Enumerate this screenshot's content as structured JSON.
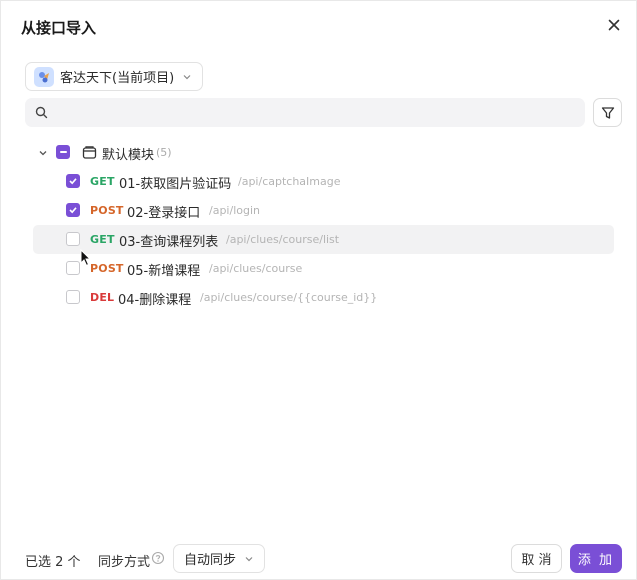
{
  "dialog": {
    "title": "从接口导入",
    "close_icon": "close-icon"
  },
  "project_select": {
    "value": "客达天下(当前项目)",
    "avatar_icon": "project-avatar-icon"
  },
  "search": {
    "placeholder": "",
    "value": ""
  },
  "tree": {
    "group": {
      "label": "默认模块",
      "count": "(5)",
      "expanded": true,
      "state": "indeterminate"
    },
    "items": [
      {
        "method": "GET",
        "name": "01-获取图片验证码",
        "path": "/api/captchaImage",
        "checked": true
      },
      {
        "method": "POST",
        "name": "02-登录接口",
        "path": "/api/login",
        "checked": true
      },
      {
        "method": "GET",
        "name": "03-查询课程列表",
        "path": "/api/clues/course/list",
        "checked": false,
        "hovered": true
      },
      {
        "method": "POST",
        "name": "05-新增课程",
        "path": "/api/clues/course",
        "checked": false
      },
      {
        "method": "DEL",
        "name": "04-删除课程",
        "path": "/api/clues/course/{{course_id}}",
        "checked": false
      }
    ]
  },
  "footer": {
    "selected_text": "已选 2 个",
    "sync_label": "同步方式",
    "sync_value": "自动同步",
    "cancel_label": "取 消",
    "add_label": "添 加"
  },
  "colors": {
    "accent": "#7a4fd6",
    "get": "#2aa565",
    "post": "#d5662a",
    "del": "#d93a3a"
  }
}
